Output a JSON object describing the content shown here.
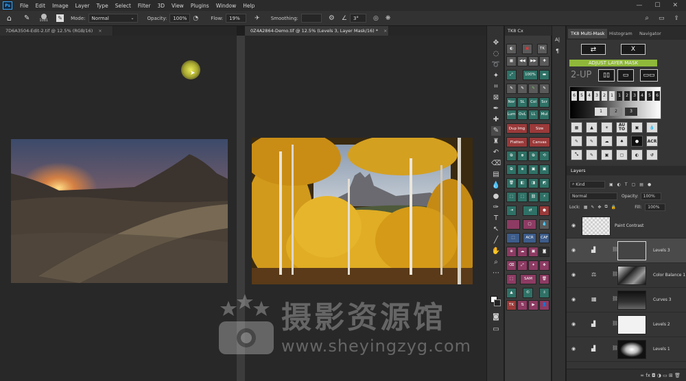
{
  "menu": {
    "logo": "Ps",
    "items": [
      "File",
      "Edit",
      "Image",
      "Layer",
      "Type",
      "Select",
      "Filter",
      "3D",
      "View",
      "Plugins",
      "Window",
      "Help"
    ],
    "window_controls": [
      "—",
      "☐",
      "✕"
    ]
  },
  "options": {
    "brush_size": "1081",
    "mode_label": "Mode:",
    "mode_value": "Normal",
    "opacity_label": "Opacity:",
    "opacity_value": "100%",
    "flow_label": "Flow:",
    "flow_value": "19%",
    "smoothing_label": "Smoothing:",
    "angle_value": "3°"
  },
  "tabs": [
    {
      "label": "7D6A3504-Edit-2.tif @ 12.5% (RGB/16)",
      "close": "×"
    },
    {
      "label": "0Z4A2864-Demo.tif @ 12.5% (Levels 3, Layer Mask/16) *",
      "close": "×"
    }
  ],
  "tk8": {
    "title": "TK8 Cx",
    "buttons": {
      "pct": "100%",
      "nor": "Nor",
      "sl": "SL",
      "col": "Col",
      "scr": "Scr",
      "lum": "Lum",
      "ovl": "OvL",
      "ll": "LL",
      "mul": "Mul",
      "dup": "Dup Img",
      "size": "Size",
      "flatten": "Flatten",
      "canvas": "Canvas",
      "acr": "ACR",
      "caf": "CAF",
      "sam": "SAM",
      "tk": "TK"
    }
  },
  "right_panel": {
    "tabs": [
      "TK8 Multi-Mask",
      "Histogram",
      "Navigator"
    ],
    "swap_icon": "⇄",
    "close_icon": "X",
    "adjust_mask": "ADJUST LAYER MASK",
    "two_up": "2-UP",
    "grid_top": [
      "6",
      "5",
      "4",
      "3",
      "2",
      "1",
      "1",
      "2",
      "3",
      "4",
      "5",
      "6"
    ],
    "grid_bottom": [
      "1",
      "2",
      "3"
    ],
    "acr": "ACR",
    "auto_a": "AU",
    "auto_b": "TO",
    "layers_title": "Layers",
    "kind_label": "Kind",
    "blend_mode": "Normal",
    "opacity_label": "Opacity:",
    "opacity_value": "100%",
    "lock_label": "Lock:",
    "fill_label": "Fill:",
    "fill_value": "100%",
    "layers": [
      {
        "name": "Paint Contrast"
      },
      {
        "name": "Levels 3"
      },
      {
        "name": "Color Balance 1"
      },
      {
        "name": "Curves 3"
      },
      {
        "name": "Levels 2"
      },
      {
        "name": "Levels 1"
      }
    ],
    "footer_icons": "∞  fx  ◘  ◑  ▭  ⊞  🗑"
  },
  "watermark": {
    "chinese": "摄影资源馆",
    "url": "www.sheyingzyg.com"
  },
  "colors": {
    "adjust_mask_green": "#8fb83a",
    "tk_teal": "#2f7166",
    "tk_red": "#9a3a3a",
    "tk_magenta": "#8d3b63"
  }
}
